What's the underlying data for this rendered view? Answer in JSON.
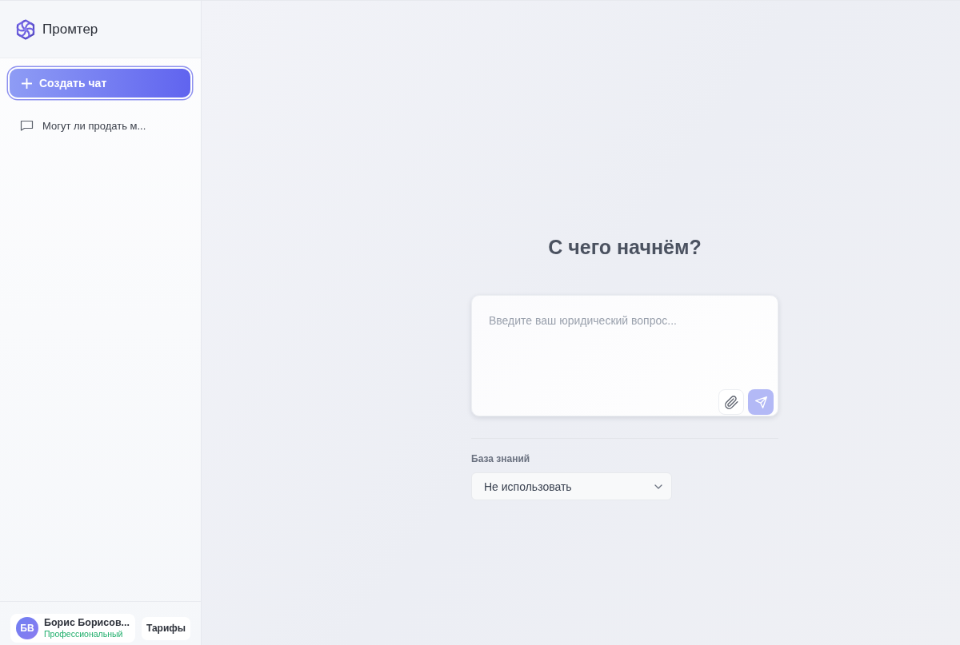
{
  "app": {
    "name": "Промтер"
  },
  "sidebar": {
    "new_chat_button": "Создать чат",
    "chats": [
      {
        "title": "Могут ли продать м...",
        "selected": false
      }
    ]
  },
  "user": {
    "initials": "БВ",
    "name": "Борис Борисов...",
    "plan": "Профессиональный"
  },
  "tariffs_button": "Тарифы",
  "main": {
    "heading": "С чего начнём?",
    "question_field": {
      "placeholder": "Введите ваш юридический вопрос..."
    },
    "send_button": {
      "disabled": true
    },
    "knowledge_base": {
      "label": "База знаний",
      "value": "Не использовать"
    }
  }
}
